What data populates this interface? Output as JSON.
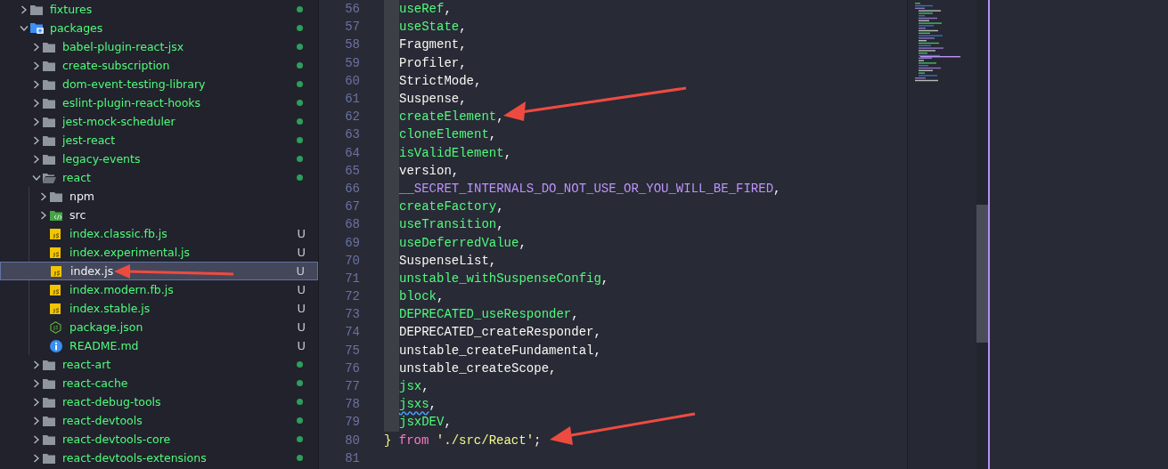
{
  "sidebar": {
    "items": [
      {
        "label": "fixtures",
        "kind": "folder",
        "expanded": false,
        "selected": false,
        "changes": true
      },
      {
        "label": "packages",
        "kind": "package-folder",
        "expanded": true,
        "selected": false,
        "changes": true,
        "children": [
          {
            "label": "babel-plugin-react-jsx",
            "kind": "folder",
            "expanded": false,
            "selected": false,
            "changes": true
          },
          {
            "label": "create-subscription",
            "kind": "folder",
            "expanded": false,
            "selected": false,
            "changes": true
          },
          {
            "label": "dom-event-testing-library",
            "kind": "folder",
            "expanded": false,
            "selected": false,
            "changes": true
          },
          {
            "label": "eslint-plugin-react-hooks",
            "kind": "folder",
            "expanded": false,
            "selected": false,
            "changes": true
          },
          {
            "label": "jest-mock-scheduler",
            "kind": "folder",
            "expanded": false,
            "selected": false,
            "changes": true
          },
          {
            "label": "jest-react",
            "kind": "folder",
            "expanded": false,
            "selected": false,
            "changes": true
          },
          {
            "label": "legacy-events",
            "kind": "folder",
            "expanded": false,
            "selected": false,
            "changes": true
          },
          {
            "label": "react",
            "kind": "folder",
            "expanded": true,
            "selected": false,
            "changes": true,
            "children": [
              {
                "label": "npm",
                "kind": "folder",
                "expanded": false,
                "selected": false,
                "changes": false
              },
              {
                "label": "src",
                "kind": "src-folder",
                "expanded": false,
                "selected": false,
                "changes": false
              },
              {
                "label": "index.classic.fb.js",
                "kind": "js",
                "selected": false,
                "status": "U"
              },
              {
                "label": "index.experimental.js",
                "kind": "js",
                "selected": false,
                "status": "U"
              },
              {
                "label": "index.js",
                "kind": "js",
                "selected": true,
                "status": "U"
              },
              {
                "label": "index.modern.fb.js",
                "kind": "js",
                "selected": false,
                "status": "U"
              },
              {
                "label": "index.stable.js",
                "kind": "js",
                "selected": false,
                "status": "U"
              },
              {
                "label": "package.json",
                "kind": "json",
                "selected": false,
                "status": "U"
              },
              {
                "label": "README.md",
                "kind": "info",
                "selected": false,
                "status": "U"
              }
            ]
          },
          {
            "label": "react-art",
            "kind": "folder",
            "expanded": false,
            "selected": false,
            "changes": true
          },
          {
            "label": "react-cache",
            "kind": "folder",
            "expanded": false,
            "selected": false,
            "changes": true
          },
          {
            "label": "react-debug-tools",
            "kind": "folder",
            "expanded": false,
            "selected": false,
            "changes": true
          },
          {
            "label": "react-devtools",
            "kind": "folder",
            "expanded": false,
            "selected": false,
            "changes": true
          },
          {
            "label": "react-devtools-core",
            "kind": "folder",
            "expanded": false,
            "selected": false,
            "changes": true
          },
          {
            "label": "react-devtools-extensions",
            "kind": "folder",
            "expanded": false,
            "selected": false,
            "changes": true
          }
        ]
      }
    ]
  },
  "editor": {
    "lines": [
      {
        "number": "56",
        "in_block": true,
        "segments": [
          {
            "text": "useRef",
            "kind": "import"
          },
          {
            "text": ",",
            "kind": "punct"
          }
        ]
      },
      {
        "number": "57",
        "in_block": true,
        "segments": [
          {
            "text": "useState",
            "kind": "import"
          },
          {
            "text": ",",
            "kind": "punct"
          }
        ]
      },
      {
        "number": "58",
        "in_block": true,
        "segments": [
          {
            "text": "Fragment",
            "kind": "plain"
          },
          {
            "text": ",",
            "kind": "punct"
          }
        ]
      },
      {
        "number": "59",
        "in_block": true,
        "segments": [
          {
            "text": "Profiler",
            "kind": "plain"
          },
          {
            "text": ",",
            "kind": "punct"
          }
        ]
      },
      {
        "number": "60",
        "in_block": true,
        "segments": [
          {
            "text": "StrictMode",
            "kind": "plain"
          },
          {
            "text": ",",
            "kind": "punct"
          }
        ]
      },
      {
        "number": "61",
        "in_block": true,
        "segments": [
          {
            "text": "Suspense",
            "kind": "plain"
          },
          {
            "text": ",",
            "kind": "punct"
          }
        ]
      },
      {
        "number": "62",
        "in_block": true,
        "segments": [
          {
            "text": "createElement",
            "kind": "import"
          },
          {
            "text": ",",
            "kind": "punct"
          }
        ]
      },
      {
        "number": "63",
        "in_block": true,
        "segments": [
          {
            "text": "cloneElement",
            "kind": "import"
          },
          {
            "text": ",",
            "kind": "punct"
          }
        ]
      },
      {
        "number": "64",
        "in_block": true,
        "segments": [
          {
            "text": "isValidElement",
            "kind": "import"
          },
          {
            "text": ",",
            "kind": "punct"
          }
        ]
      },
      {
        "number": "65",
        "in_block": true,
        "segments": [
          {
            "text": "version",
            "kind": "plain"
          },
          {
            "text": ",",
            "kind": "punct"
          }
        ]
      },
      {
        "number": "66",
        "in_block": true,
        "segments": [
          {
            "text": "__SECRET_INTERNALS_DO_NOT_USE_OR_YOU_WILL_BE_FIRED",
            "kind": "constant"
          },
          {
            "text": ",",
            "kind": "punct"
          }
        ]
      },
      {
        "number": "67",
        "in_block": true,
        "segments": [
          {
            "text": "createFactory",
            "kind": "import"
          },
          {
            "text": ",",
            "kind": "punct"
          }
        ]
      },
      {
        "number": "68",
        "in_block": true,
        "segments": [
          {
            "text": "useTransition",
            "kind": "import"
          },
          {
            "text": ",",
            "kind": "punct"
          }
        ]
      },
      {
        "number": "69",
        "in_block": true,
        "segments": [
          {
            "text": "useDeferredValue",
            "kind": "import"
          },
          {
            "text": ",",
            "kind": "punct"
          }
        ]
      },
      {
        "number": "70",
        "in_block": true,
        "segments": [
          {
            "text": "SuspenseList",
            "kind": "plain"
          },
          {
            "text": ",",
            "kind": "punct"
          }
        ]
      },
      {
        "number": "71",
        "in_block": true,
        "segments": [
          {
            "text": "unstable_withSuspenseConfig",
            "kind": "import"
          },
          {
            "text": ",",
            "kind": "punct"
          }
        ]
      },
      {
        "number": "72",
        "in_block": true,
        "segments": [
          {
            "text": "block",
            "kind": "import"
          },
          {
            "text": ",",
            "kind": "punct"
          }
        ]
      },
      {
        "number": "73",
        "in_block": true,
        "segments": [
          {
            "text": "DEPRECATED_useResponder",
            "kind": "import"
          },
          {
            "text": ",",
            "kind": "punct"
          }
        ]
      },
      {
        "number": "74",
        "in_block": true,
        "segments": [
          {
            "text": "DEPRECATED_createResponder",
            "kind": "plain"
          },
          {
            "text": ",",
            "kind": "punct"
          }
        ]
      },
      {
        "number": "75",
        "in_block": true,
        "segments": [
          {
            "text": "unstable_createFundamental",
            "kind": "plain"
          },
          {
            "text": ",",
            "kind": "punct"
          }
        ]
      },
      {
        "number": "76",
        "in_block": true,
        "segments": [
          {
            "text": "unstable_createScope",
            "kind": "plain"
          },
          {
            "text": ",",
            "kind": "punct"
          }
        ]
      },
      {
        "number": "77",
        "in_block": true,
        "segments": [
          {
            "text": "jsx",
            "kind": "import"
          },
          {
            "text": ",",
            "kind": "punct"
          }
        ]
      },
      {
        "number": "78",
        "in_block": true,
        "segments": [
          {
            "text": "jsxs",
            "kind": "import",
            "warning": true
          },
          {
            "text": ",",
            "kind": "punct"
          }
        ]
      },
      {
        "number": "79",
        "in_block": true,
        "segments": [
          {
            "text": "jsxDEV",
            "kind": "import"
          },
          {
            "text": ",",
            "kind": "punct"
          }
        ]
      },
      {
        "number": "80",
        "segments": [
          {
            "text": "} ",
            "kind": "brace"
          },
          {
            "text": "from ",
            "kind": "keyword"
          },
          {
            "text": "'./src/React'",
            "kind": "string"
          },
          {
            "text": ";",
            "kind": "punct"
          }
        ]
      },
      {
        "number": "81"
      }
    ]
  }
}
